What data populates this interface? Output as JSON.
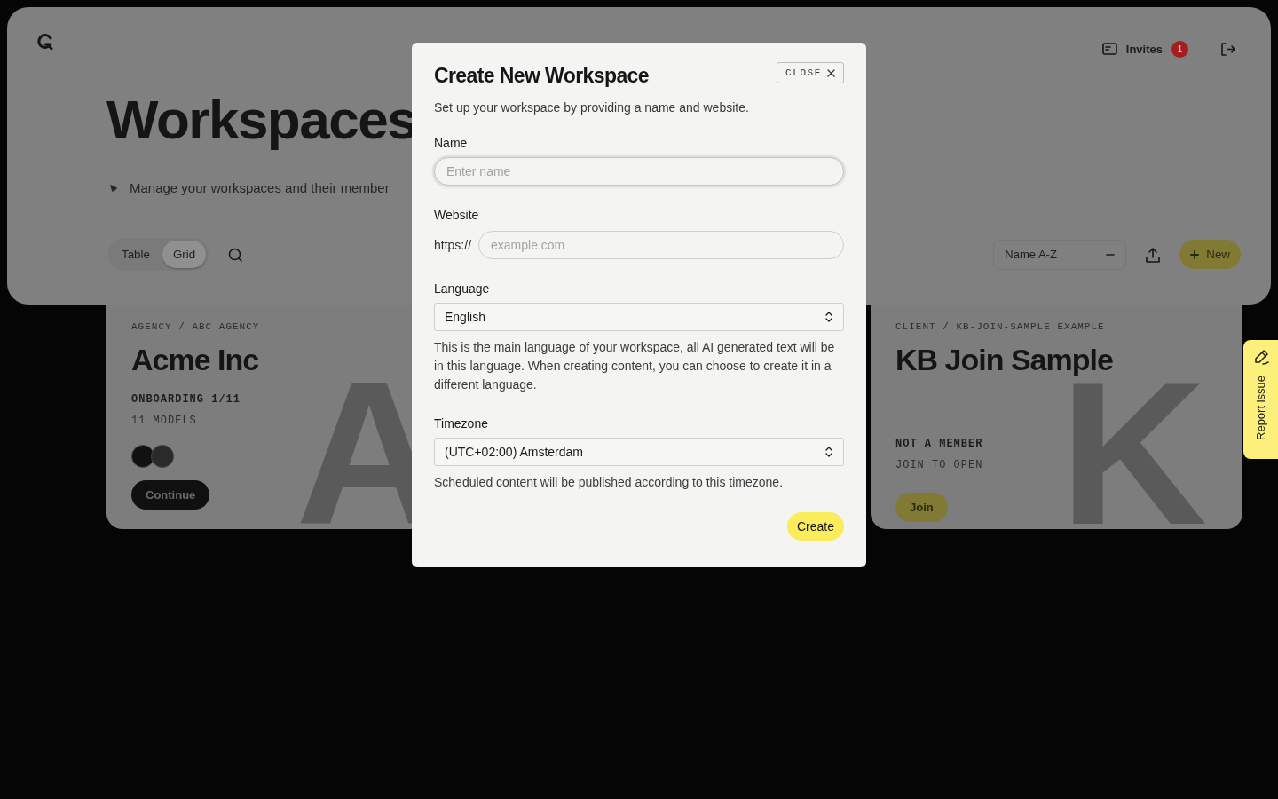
{
  "header": {
    "invites": {
      "label": "Invites",
      "count": "1"
    }
  },
  "page": {
    "title": "Workspaces",
    "subtitle": "Manage your workspaces and their member",
    "view_tabs": [
      {
        "label": "Table",
        "selected": false
      },
      {
        "label": "Grid",
        "selected": true
      }
    ],
    "sort": {
      "value": "Name A-Z"
    },
    "new_button": "New"
  },
  "cards": [
    {
      "kind": "member",
      "breadcrumb": "AGENCY / ABC AGENCY",
      "title": "Acme Inc",
      "letter": "A",
      "meta": [
        "ONBOARDING 1/11",
        "11 MODELS"
      ],
      "avatars": [
        {
          "kind": "dark"
        },
        {
          "kind": "light"
        }
      ],
      "action": "Continue"
    },
    {
      "kind": "guest",
      "breadcrumb": "CLIENT / KB-JOIN-SAMPLE EXAMPLE",
      "title": "KB Join Sample",
      "letter": "K",
      "meta": [
        "NOT A MEMBER",
        "JOIN TO OPEN"
      ],
      "action": "Join"
    }
  ],
  "dialog": {
    "title": "Create New Workspace",
    "close": "CLOSE",
    "description": "Set up your workspace by providing a name and website.",
    "fields": [
      {
        "kind": "text",
        "label": "Name",
        "placeholder": "Enter name",
        "focused": true
      },
      {
        "kind": "url",
        "label": "Website",
        "prefix": "https://",
        "placeholder": "example.com",
        "focused": false
      },
      {
        "kind": "select",
        "label": "Language",
        "value": "English",
        "help": "This is the main language of your workspace, all AI generated text will be in this language. When creating content, you can choose to create it in a different language."
      },
      {
        "kind": "select",
        "label": "Timezone",
        "value": "(UTC+02:00) Amsterdam",
        "help": "Scheduled content will be published according to this timezone."
      }
    ],
    "submit": "Create"
  },
  "report_tab": {
    "label": "Report issue"
  }
}
